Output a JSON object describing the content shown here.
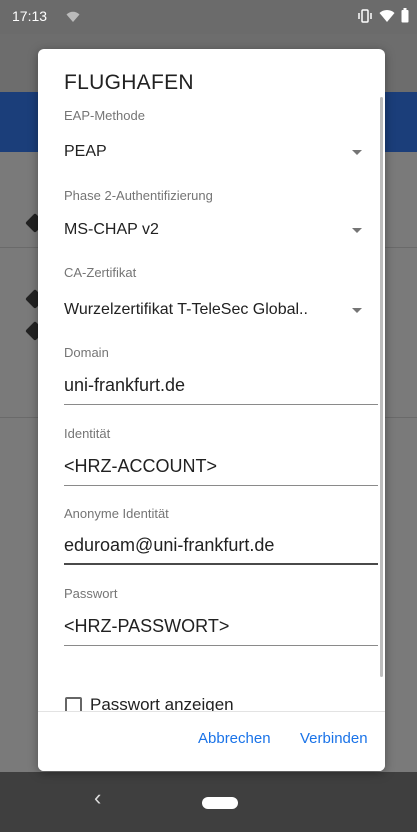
{
  "status_bar": {
    "time": "17:13"
  },
  "dialog": {
    "title": "FLUGHAFEN",
    "eap_method": {
      "label": "EAP-Methode",
      "value": "PEAP"
    },
    "phase2": {
      "label": "Phase 2-Authentifizierung",
      "value": "MS-CHAP v2"
    },
    "ca_cert": {
      "label": "CA-Zertifikat",
      "value": "Wurzelzertifikat T-TeleSec Global.."
    },
    "domain": {
      "label": "Domain",
      "value": "uni-frankfurt.de"
    },
    "identity": {
      "label": "Identität",
      "value": "<HRZ-ACCOUNT>"
    },
    "anon_identity": {
      "label": "Anonyme Identität",
      "value": "eduroam@uni-frankfurt.de"
    },
    "password": {
      "label": "Passwort",
      "value": "<HRZ-PASSWORT>"
    },
    "show_password": {
      "label": "Passwort anzeigen",
      "checked": false
    },
    "buttons": {
      "cancel": "Abbrechen",
      "connect": "Verbinden"
    }
  },
  "accent_color": "#1a73e8",
  "icons": [
    "wifi-icon",
    "vibrate-icon",
    "signal-icon",
    "battery-icon",
    "dropdown-caret-icon",
    "back-nav-icon",
    "home-nav-icon"
  ]
}
